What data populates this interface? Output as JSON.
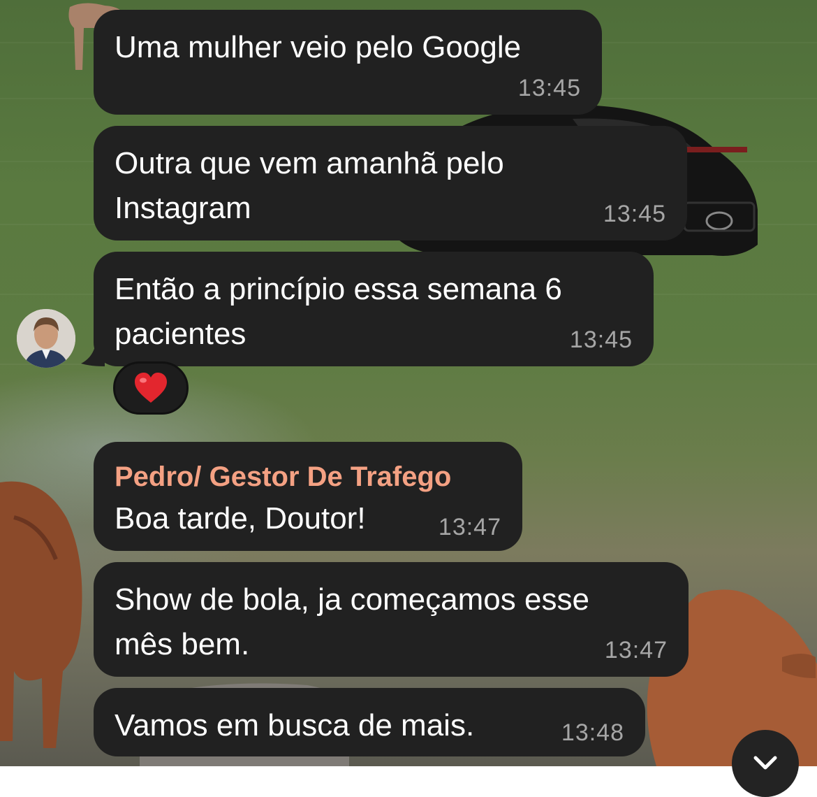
{
  "chat": {
    "messages": [
      {
        "text": "Uma mulher veio pelo Google",
        "time": "13:45"
      },
      {
        "text": "Outra que vem amanhã pelo\nInstagram",
        "time": "13:45"
      },
      {
        "text": "Então a princípio essa semana 6\npacientes",
        "time": "13:45",
        "reaction": "❤️"
      },
      {
        "sender": "Pedro/ Gestor De Trafego",
        "text": "Boa tarde, Doutor!",
        "time": "13:47"
      },
      {
        "text": "Show de bola, ja começamos esse\nmês bem.",
        "time": "13:47"
      },
      {
        "text": "Vamos em busca de mais.",
        "time": "13:48"
      }
    ]
  },
  "colors": {
    "bubble_bg": "#212121",
    "sender_name": "#f4a183",
    "timestamp": "#a6a6a6"
  },
  "icons": {
    "reaction": "heart-icon",
    "scroll": "chevron-down-icon"
  }
}
